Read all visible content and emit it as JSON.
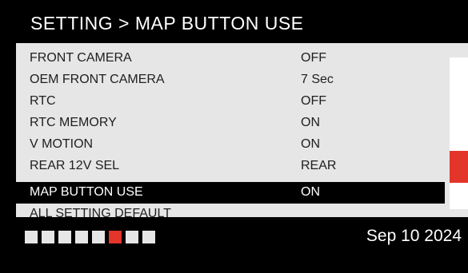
{
  "header": {
    "title": "SETTING > MAP BUTTON USE"
  },
  "menu": {
    "items": [
      {
        "label": "FRONT CAMERA",
        "value": "OFF",
        "selected": false
      },
      {
        "label": "OEM FRONT CAMERA",
        "value": "7 Sec",
        "selected": false
      },
      {
        "label": "RTC",
        "value": "OFF",
        "selected": false
      },
      {
        "label": "RTC MEMORY",
        "value": "ON",
        "selected": false
      },
      {
        "label": "V MOTION",
        "value": "ON",
        "selected": false
      },
      {
        "label": "REAR 12V SEL",
        "value": "REAR",
        "selected": false
      },
      {
        "label": "MAP BUTTON USE",
        "value": "ON",
        "selected": true
      },
      {
        "label": "ALL SETTING DEFAULT",
        "value": "",
        "selected": false
      }
    ],
    "scroll_position_fraction": 0.78
  },
  "footer": {
    "date": "Sep 10 2024",
    "page_count": 8,
    "active_page": 6
  },
  "colors": {
    "accent": "#e3352a",
    "panel": "#e6e6e6",
    "background": "#000000",
    "selected_row": "#000000"
  }
}
